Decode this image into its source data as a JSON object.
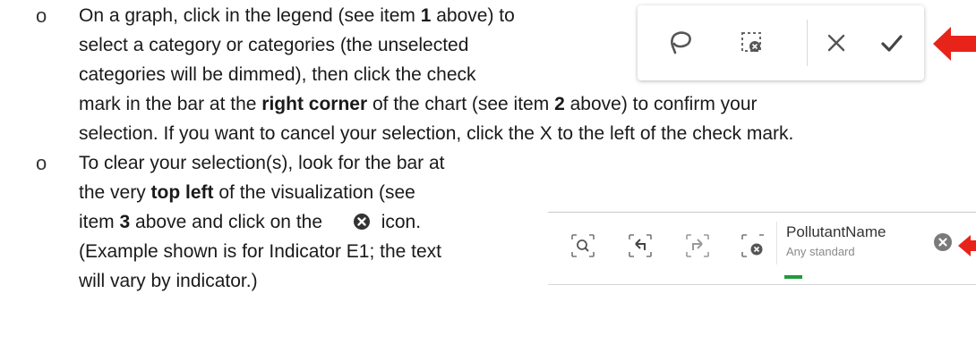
{
  "bullets": {
    "glyph": "o"
  },
  "item1": {
    "l1": "On a graph, click in the legend (see item ",
    "l1_bold": "1",
    "l1_end": " above) to",
    "l2": "select a category or categories (the unselected",
    "l3": "categories will be dimmed), then click the check",
    "l4a": "mark in the bar at the ",
    "l4_bold": "right corner",
    "l4b": " of the chart (see item ",
    "l4_bold2": "2",
    "l4c": " above) to confirm your",
    "l5": "selection. If you want to cancel your selection, click the X to the left of the check mark."
  },
  "item2": {
    "l1": "To clear your selection(s), look for the bar at",
    "l2": "the very ",
    "l2_bold": "top left",
    "l2_end": " of the visualization (see",
    "l3a": "item ",
    "l3_bold": "3",
    "l3b": " above and click on the",
    "l3c": "icon.",
    "l4": "(Example shown is for Indicator E1; the text",
    "l5": "will vary by indicator.)"
  },
  "toolbar": {
    "icons": [
      "lasso-icon",
      "clear-selection-icon",
      "cancel-icon",
      "confirm-icon"
    ]
  },
  "selection_bar": {
    "field_name": "PollutantName",
    "field_value": "Any standard",
    "icons": [
      "search-selection-icon",
      "step-back-icon",
      "step-forward-icon",
      "clear-all-icon",
      "clear-field-icon"
    ]
  },
  "colors": {
    "arrow": "#e8231a",
    "green": "#1e9c3a",
    "icon": "#555555"
  }
}
